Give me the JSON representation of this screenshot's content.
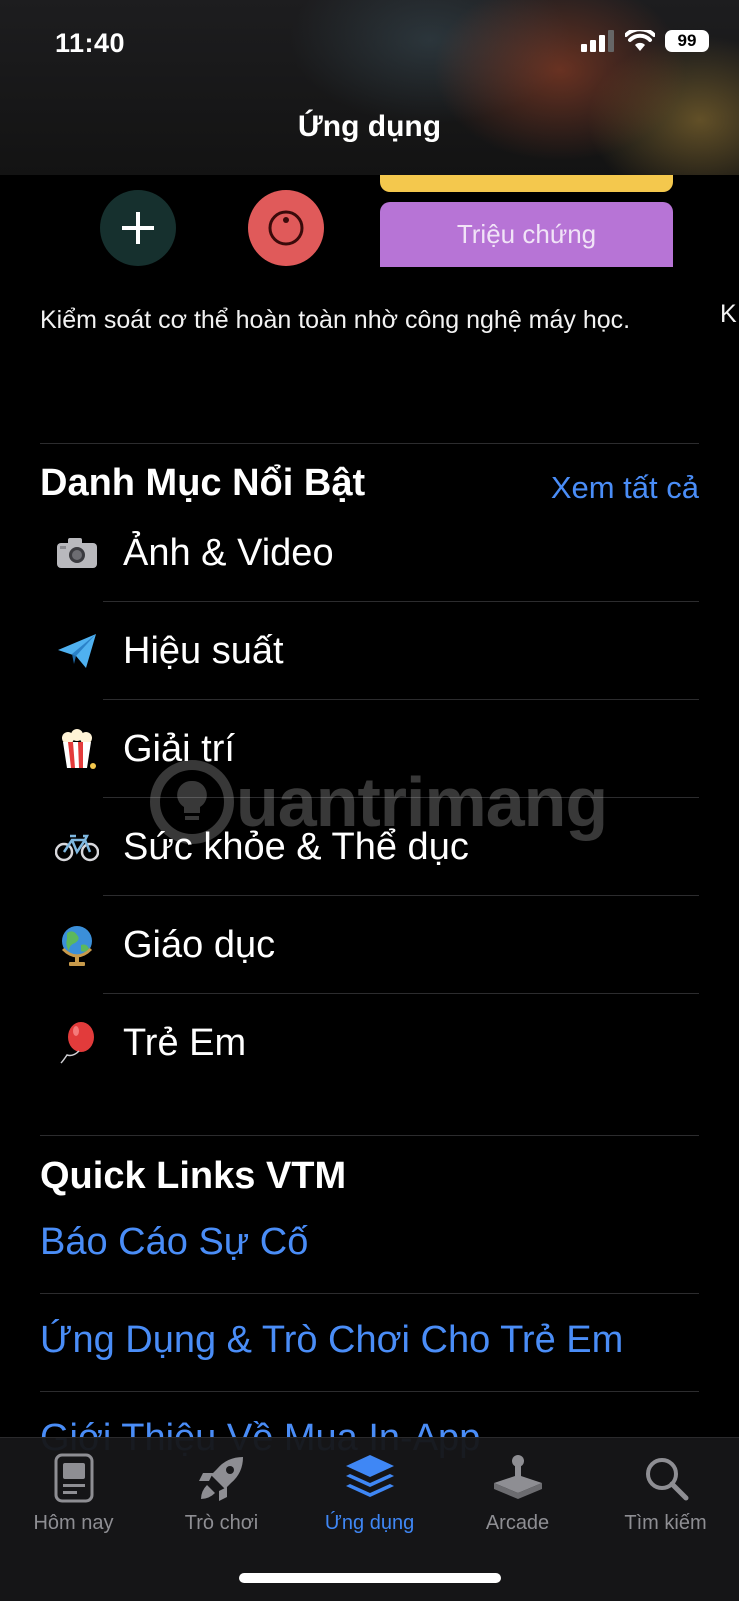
{
  "status": {
    "time": "11:40",
    "battery": "99"
  },
  "header": {
    "title": "Ứng dụng"
  },
  "featured": {
    "card_label": "Triệu chứng",
    "description": "Kiểm soát cơ thể hoàn toàn nhờ công nghệ máy học.",
    "next_peek": "K"
  },
  "categories": {
    "title": "Danh Mục Nổi Bật",
    "see_all": "Xem tất cả",
    "items": [
      {
        "label": "Ảnh & Video",
        "icon": "camera-icon"
      },
      {
        "label": "Hiệu suất",
        "icon": "paper-plane-icon"
      },
      {
        "label": "Giải trí",
        "icon": "popcorn-icon"
      },
      {
        "label": "Sức khỏe & Thể dục",
        "icon": "bicycle-icon"
      },
      {
        "label": "Giáo dục",
        "icon": "globe-icon"
      },
      {
        "label": "Trẻ Em",
        "icon": "balloon-icon"
      }
    ]
  },
  "quick_links": {
    "title": "Quick Links VTM",
    "items": [
      "Báo Cáo Sự Cố",
      "Ứng Dụng & Trò Chơi Cho Trẻ Em",
      "Giới Thiệu Về Mua In-App"
    ]
  },
  "watermark": "uantrimang",
  "tabs": [
    {
      "label": "Hôm nay",
      "icon": "today-icon",
      "active": false
    },
    {
      "label": "Trò chơi",
      "icon": "rocket-icon",
      "active": false
    },
    {
      "label": "Ứng dụng",
      "icon": "apps-stack-icon",
      "active": true
    },
    {
      "label": "Arcade",
      "icon": "joystick-icon",
      "active": false
    },
    {
      "label": "Tìm kiếm",
      "icon": "search-icon",
      "active": false
    }
  ],
  "colors": {
    "accent": "#4a8df7",
    "tab_active": "#3f87f5",
    "purple_card": "#b774d6",
    "yellow_card": "#f4c84d"
  }
}
